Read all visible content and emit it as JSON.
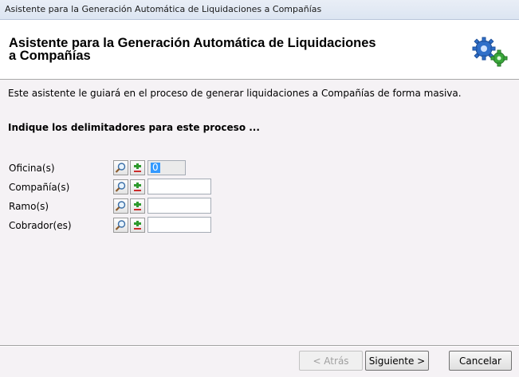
{
  "window": {
    "title": "Asistente para la Generación Automática de Liquidaciones a Compañías"
  },
  "header": {
    "title_line1": "Asistente para la Generación Automática de Liquidaciones",
    "title_line2": "a Compañías",
    "icon": "gears-icon"
  },
  "intro_text": "Este asistente le guiará en el proceso de generar liquidaciones a Compañías de forma masiva.",
  "prompt_text": "Indique los delimitadores para este proceso ...",
  "filters": [
    {
      "label": "Oficina(s)",
      "value": "0"
    },
    {
      "label": "Compañía(s)",
      "value": ""
    },
    {
      "label": "Ramo(s)",
      "value": ""
    },
    {
      "label": "Cobrador(es)",
      "value": ""
    }
  ],
  "buttons": {
    "back": "< Atrás",
    "next": "Siguiente >",
    "cancel": "Cancelar"
  },
  "icons": {
    "search": "magnifier-icon",
    "add": "add-plus-icon"
  }
}
